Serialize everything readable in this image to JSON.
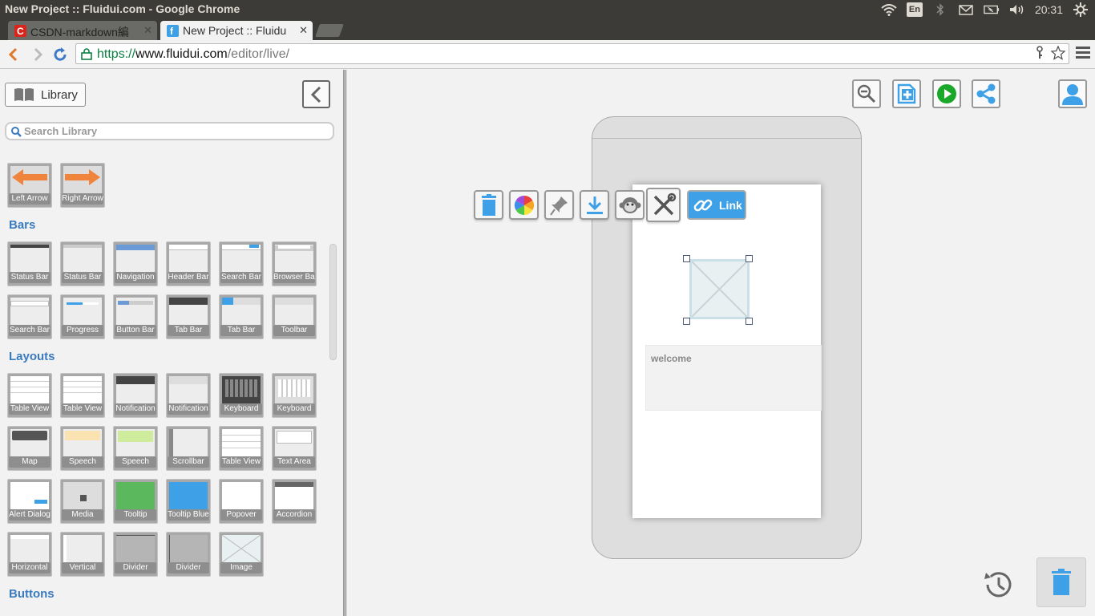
{
  "os": {
    "window_title": "New Project :: Fluidui.com - Google Chrome",
    "keyboard_layout": "En",
    "clock": "20:31"
  },
  "browser": {
    "tabs": [
      {
        "title": "CSDN-markdown編",
        "favicon_color": "#d9261c",
        "active": false
      },
      {
        "title": "New Project :: Fluidu",
        "favicon_color": "#3ea1e8",
        "active": true
      }
    ],
    "url": {
      "scheme": "https://",
      "host": "www.fluidui.com",
      "path": "/editor/live/"
    }
  },
  "library": {
    "button_label": "Library",
    "search_placeholder": "Search Library",
    "arrows": [
      {
        "label": "Left Arrow"
      },
      {
        "label": "Right Arrow"
      }
    ],
    "sections": [
      {
        "title": "Bars",
        "items": [
          "Status Bar",
          "Status Bar",
          "Navigation",
          "Header Bar",
          "Search Bar",
          "Browser Bar",
          "Search Bar",
          "Progress",
          "Button Bar",
          "Tab Bar",
          "Tab Bar",
          "Toolbar"
        ]
      },
      {
        "title": "Layouts",
        "items": [
          "Table View",
          "Table View",
          "Notification",
          "Notification",
          "Keyboard",
          "Keyboard",
          "Map",
          "Speech",
          "Speech",
          "Scrollbar",
          "Table View",
          "Text Area",
          "Alert Dialog",
          "Media",
          "Tooltip",
          "Tooltip Blue",
          "Popover",
          "Accordion",
          "Horizontal",
          "Vertical",
          "Divider",
          "Divider",
          "Image"
        ]
      },
      {
        "title": "Buttons",
        "items": []
      }
    ]
  },
  "canvas": {
    "context_toolbar": {
      "tools": [
        "trash-icon",
        "color-wheel-icon",
        "pin-icon",
        "download-icon",
        "monkey-icon",
        "wrench-icon"
      ],
      "link_label": "Link"
    },
    "text_block": "welcome",
    "top_tools": [
      "zoom-out-icon",
      "add-page-icon",
      "play-icon",
      "share-icon",
      "user-icon"
    ],
    "accent_color": "#3ea1e8",
    "play_color": "#1aa82a"
  }
}
